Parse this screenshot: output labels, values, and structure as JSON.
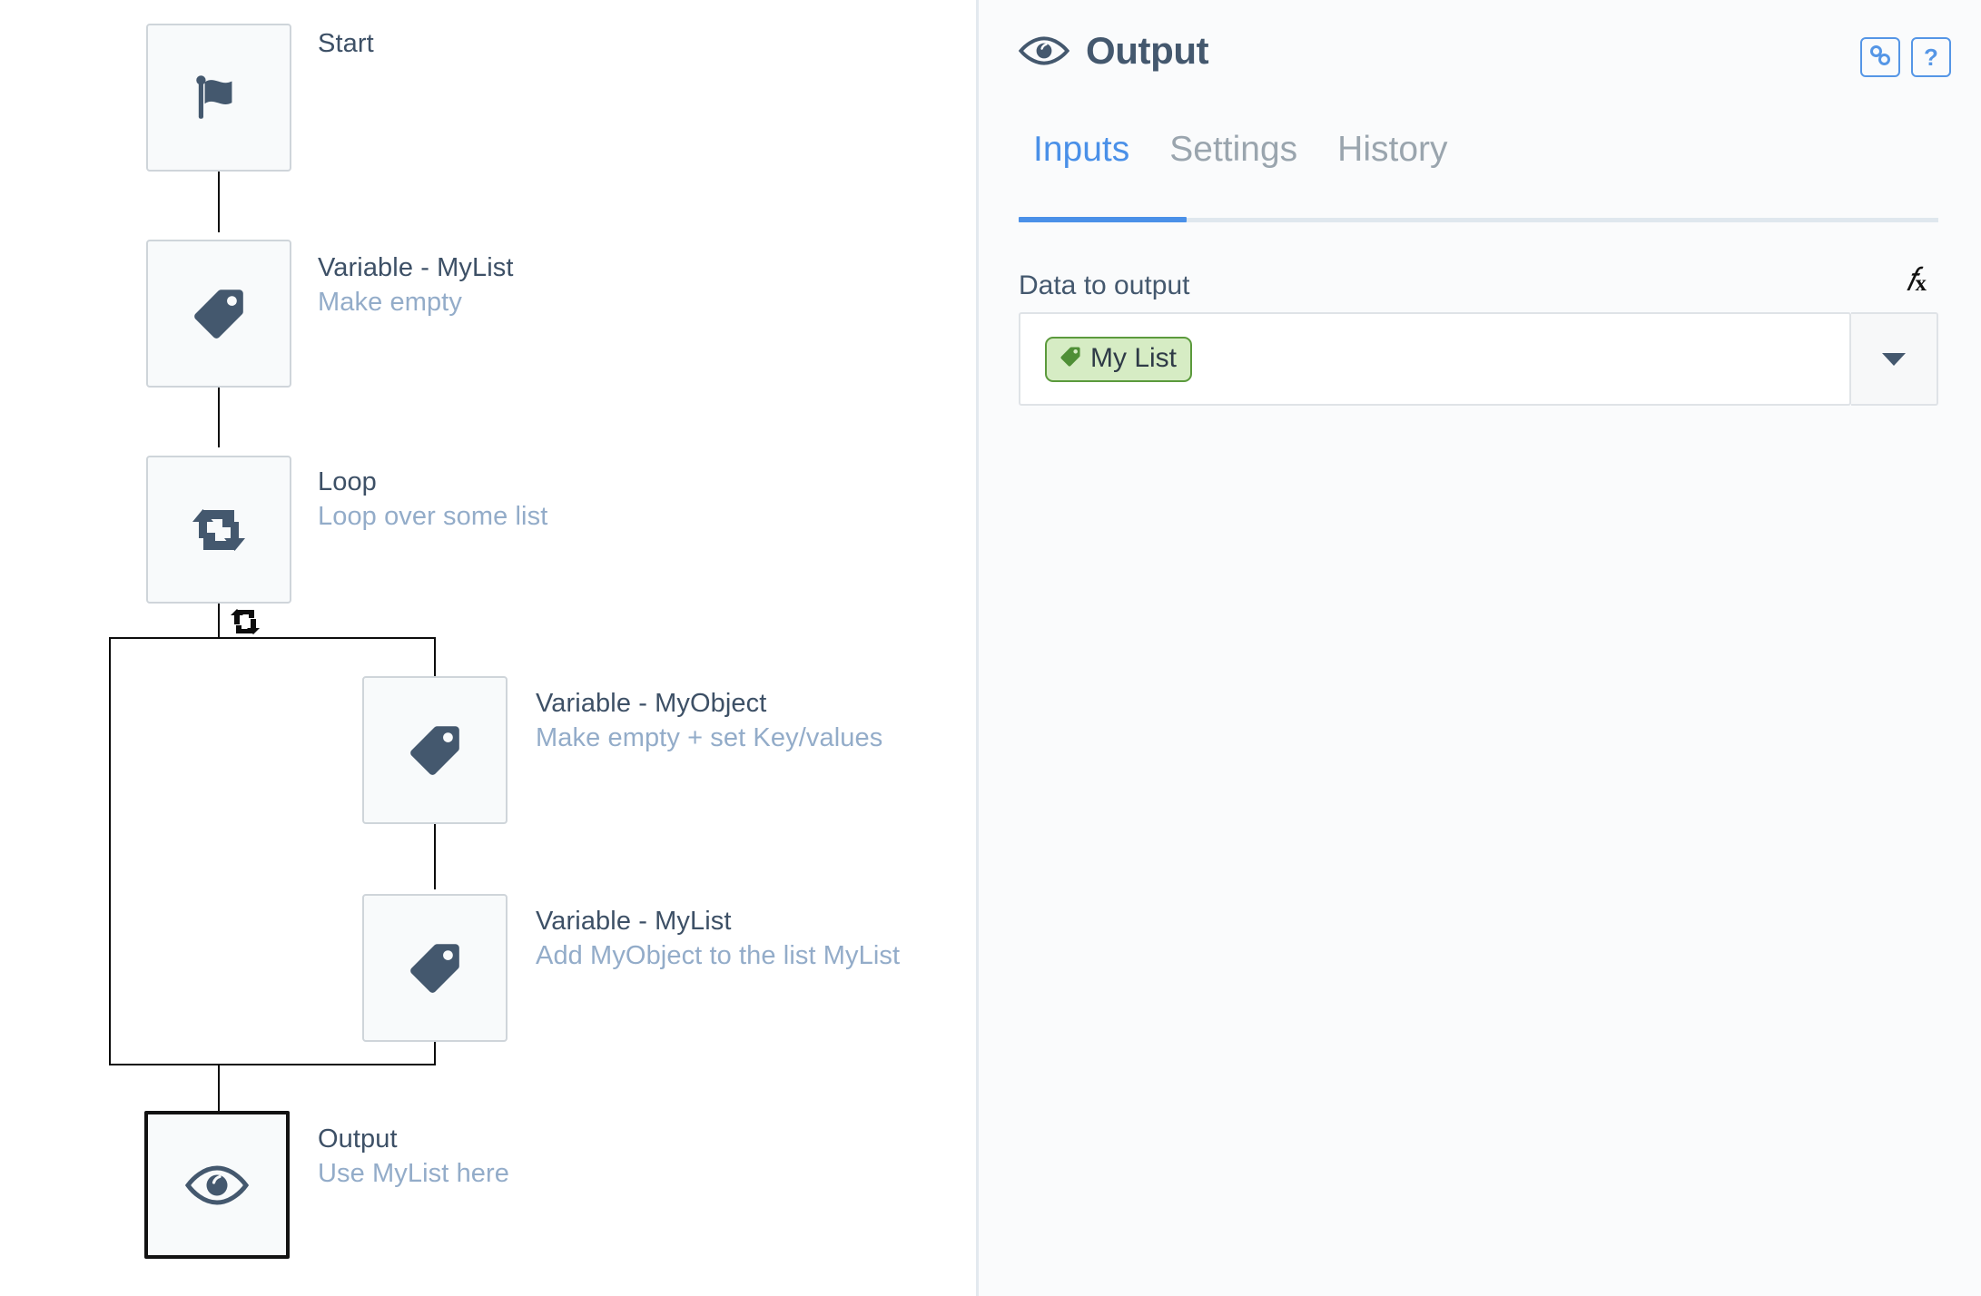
{
  "flow": {
    "nodes": [
      {
        "id": "start",
        "title": "Start",
        "subtitle": "",
        "icon": "flag-icon"
      },
      {
        "id": "var-mylist",
        "title": "Variable - MyList",
        "subtitle": "Make empty",
        "icon": "tag-icon"
      },
      {
        "id": "loop",
        "title": "Loop",
        "subtitle": "Loop over some list",
        "icon": "loop-icon"
      },
      {
        "id": "var-myobject",
        "title": "Variable - MyObject",
        "subtitle": "Make empty + set Key/values",
        "icon": "tag-icon"
      },
      {
        "id": "var-mylist-2",
        "title": "Variable - MyList",
        "subtitle": "Add MyObject to the list MyList",
        "icon": "tag-icon"
      },
      {
        "id": "output",
        "title": "Output",
        "subtitle": "Use MyList here",
        "icon": "eye-icon"
      }
    ],
    "loop_marker_icon": "loop-repeat-icon"
  },
  "panel": {
    "title": "Output",
    "title_icon": "eye-icon",
    "actions": [
      {
        "id": "link",
        "icon": "link-icon",
        "label": ""
      },
      {
        "id": "help",
        "icon": "question-icon",
        "label": "?"
      }
    ],
    "tabs": [
      {
        "id": "inputs",
        "label": "Inputs",
        "active": true
      },
      {
        "id": "settings",
        "label": "Settings",
        "active": false
      },
      {
        "id": "history",
        "label": "History",
        "active": false
      }
    ],
    "fields": [
      {
        "id": "data-to-output",
        "label": "Data to output",
        "formula_icon": "fx-icon",
        "chip": {
          "label": "My List",
          "icon": "tag-icon",
          "color": "#5b9a3c",
          "background": "#d6ecc4"
        },
        "dropdown_icon": "chevron-down-icon"
      }
    ]
  },
  "colors": {
    "accent": "#4a90e8",
    "node_icon": "#44586e",
    "node_title": "#3d5066",
    "node_subtitle": "#93acc9",
    "chip_green": "#5b9a3c",
    "panel_bg": "#fafbfc",
    "divider": "#e3e9ef"
  }
}
